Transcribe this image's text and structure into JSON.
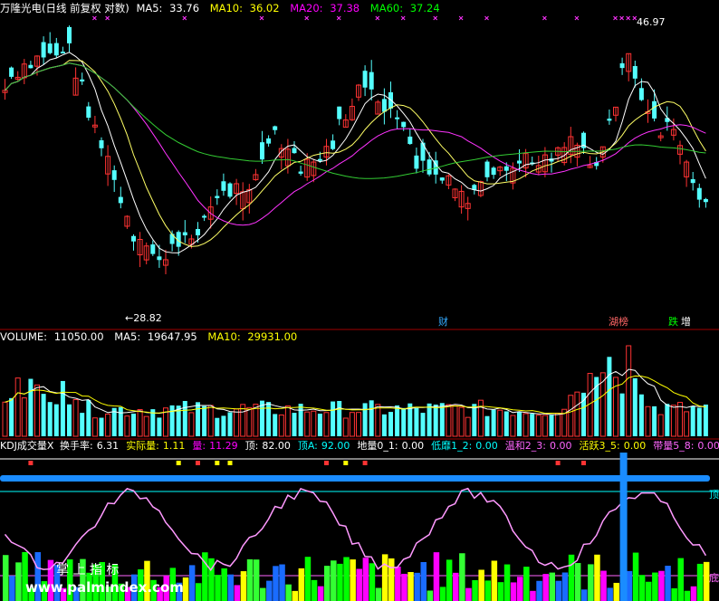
{
  "colors": {
    "background": "#000000",
    "white": "#ffffff",
    "yellow": "#ffff00",
    "magenta": "#ff00ff",
    "green": "#00ff00",
    "up_candle": "#ff3333",
    "down_candle": "#54ffff",
    "cyan": "#00ffff",
    "blue": "#1a8cff",
    "pink": "#ff99ff",
    "dark_red": "#8b0000",
    "dark_green": "#006400",
    "lime": "#33ff33",
    "orange": "#ff9900",
    "ma5_line": "#ffffff",
    "ma10_line": "#ffff66",
    "ma20_line": "#ff33ff",
    "ma60_line": "#33cc33"
  },
  "price_panel": {
    "stock_name": "万隆光电",
    "params": "(日线 前复权 对数)",
    "ma5_label": "MA5:",
    "ma5_value": "33.76",
    "ma10_label": "MA10:",
    "ma10_value": "36.02",
    "ma20_label": "MA20:",
    "ma20_value": "37.38",
    "ma60_label": "MA60:",
    "ma60_value": "37.24",
    "high_label": "46.97",
    "low_label": "28.82",
    "event_marks": [
      {
        "text": "财",
        "color": "#33aaff"
      },
      {
        "text": "湖榜",
        "color": "#ff6666"
      },
      {
        "text": "跌",
        "color": "#00ff00"
      },
      {
        "text": "增",
        "color": "#ffffff"
      }
    ]
  },
  "volume_panel": {
    "volume_label": "VOLUME:",
    "volume_value": "11050.00",
    "ma5_label": "MA5:",
    "ma5_value": "19647.95",
    "ma10_label": "MA10:",
    "ma10_value": "29931.00"
  },
  "indicator_panel": {
    "name": "KDJ成交量X",
    "items": [
      {
        "label": "换手率:",
        "value": "6.31",
        "color": "#ffffff"
      },
      {
        "label": "实际量:",
        "value": "1.11",
        "color": "#ffff00"
      },
      {
        "label": "量:",
        "value": "11.29",
        "color": "#ff00ff"
      },
      {
        "label": "顶:",
        "value": "82.00",
        "color": "#ffffff"
      },
      {
        "label": "顶A:",
        "value": "92.00",
        "color": "#00ffff"
      },
      {
        "label": "地量0_1:",
        "value": "0.00",
        "color": "#ffffff"
      },
      {
        "label": "低靡1_2:",
        "value": "0.00",
        "color": "#00ffff"
      },
      {
        "label": "温和2_3:",
        "value": "0.00",
        "color": "#ff66ff"
      },
      {
        "label": "活跃3_5:",
        "value": "0.00",
        "color": "#ffff00"
      },
      {
        "label": "带量5_8:",
        "value": "0.00",
        "color": "#ff66ff"
      }
    ],
    "right_tag": "顶",
    "right_tag2": "底",
    "watermark_brand": "掌 上 指 标",
    "watermark_url": "www.palmindex.com"
  }
}
